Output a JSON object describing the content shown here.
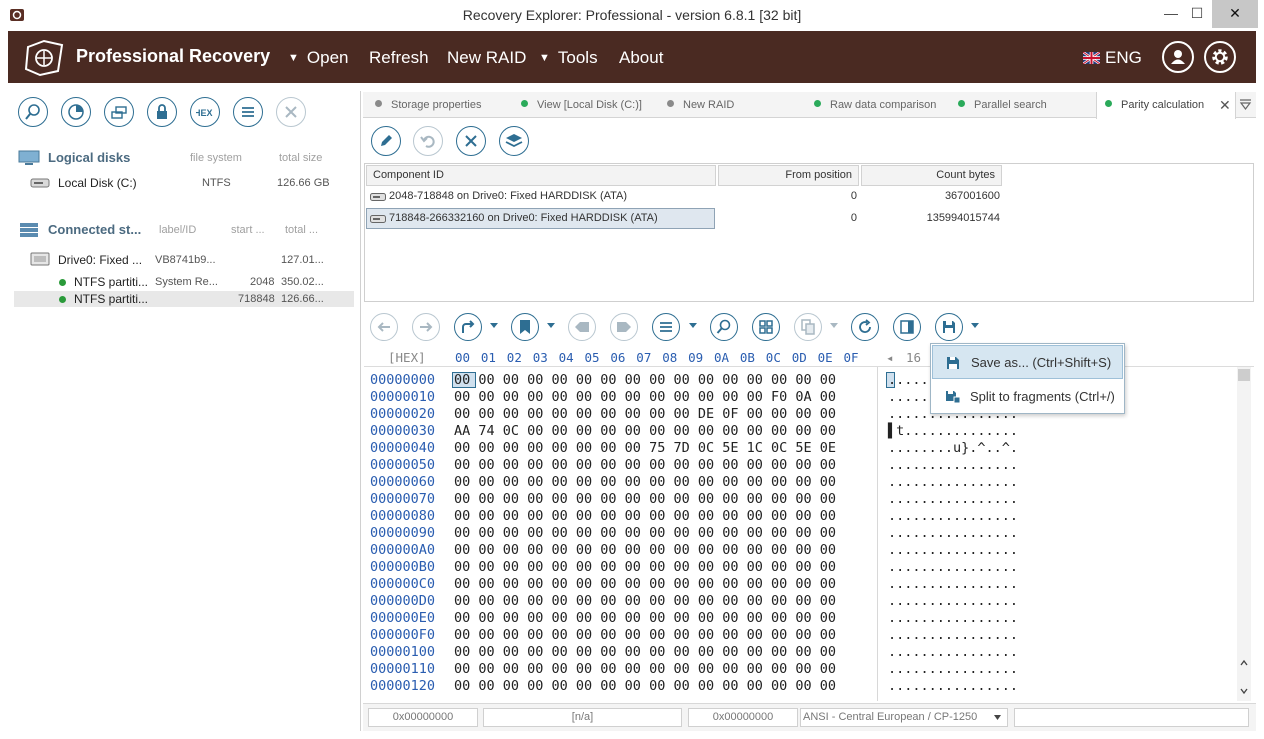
{
  "window": {
    "title": "Recovery Explorer: Professional - version 6.8.1 [32 bit]",
    "minimize": "—",
    "maximize": "☐",
    "close": "✕"
  },
  "menubar": {
    "brand": "Professional Recovery",
    "items": {
      "open": "Open",
      "refresh": "Refresh",
      "new_raid": "New RAID",
      "tools": "Tools",
      "about": "About"
    },
    "dropdown_caret": "▼",
    "language": "ENG"
  },
  "left": {
    "logical": {
      "title": "Logical disks",
      "col_fs": "file system",
      "col_size": "total size",
      "rows": [
        {
          "name": "Local Disk (C:)",
          "fs": "NTFS",
          "size": "126.66 GB"
        }
      ]
    },
    "connected": {
      "title": "Connected st...",
      "col_label": "label/ID",
      "col_start": "start ...",
      "col_total": "total ...",
      "drive": {
        "name": "Drive0: Fixed ...",
        "label": "VB8741b9...",
        "total": "127.01..."
      },
      "partitions": [
        {
          "name": "NTFS partiti...",
          "label": "System Re...",
          "start": "2048",
          "total": "350.02..."
        },
        {
          "name": "NTFS partiti...",
          "label": "",
          "start": "718848",
          "total": "126.66..."
        }
      ]
    }
  },
  "tabs": [
    {
      "label": "Storage properties",
      "dot": "#8a8a8a"
    },
    {
      "label": "View [Local Disk (C:)]",
      "dot": "#2aaa5a"
    },
    {
      "label": "New RAID",
      "dot": "#8a8a8a"
    },
    {
      "label": "Raw data comparison",
      "dot": "#2aaa5a"
    },
    {
      "label": "Parallel search",
      "dot": "#2aaa5a"
    },
    {
      "label": "Parity calculation",
      "dot": "#2aaa5a",
      "close": "✕"
    }
  ],
  "component_table": {
    "headers": {
      "id": "Component ID",
      "from": "From position",
      "count": "Count bytes"
    },
    "rows": [
      {
        "id": "2048-718848 on Drive0: Fixed HARDDISK (ATA)",
        "from": "0",
        "count": "367001600"
      },
      {
        "id": "718848-266332160 on Drive0: Fixed HARDDISK (ATA)",
        "from": "0",
        "count": "135994015744"
      }
    ]
  },
  "hex": {
    "header_label": "[HEX]",
    "columns": [
      "00",
      "01",
      "02",
      "03",
      "04",
      "05",
      "06",
      "07",
      "08",
      "09",
      "0A",
      "0B",
      "0C",
      "0D",
      "0E",
      "0F"
    ],
    "width_label": "16",
    "rows": [
      {
        "off": "00000000",
        "bytes": "00 00 00 00 00 00 00 00 00 00 00 00 00 00 00 00",
        "ascii": "................"
      },
      {
        "off": "00000010",
        "bytes": "00 00 00 00 00 00 00 00 00 00 00 00 00 F0 0A 00",
        "ascii": "................"
      },
      {
        "off": "00000020",
        "bytes": "00 00 00 00 00 00 00 00 00 00 DE 0F 00 00 00 00",
        "ascii": "................"
      },
      {
        "off": "00000030",
        "bytes": "AA 74 0C 00 00 00 00 00 00 00 00 00 00 00 00 00",
        "ascii": "▌t.............."
      },
      {
        "off": "00000040",
        "bytes": "00 00 00 00 00 00 00 00 75 7D 0C 5E 1C 0C 5E 0E",
        "ascii": "........u}.^..^."
      },
      {
        "off": "00000050",
        "bytes": "00 00 00 00 00 00 00 00 00 00 00 00 00 00 00 00",
        "ascii": "................"
      },
      {
        "off": "00000060",
        "bytes": "00 00 00 00 00 00 00 00 00 00 00 00 00 00 00 00",
        "ascii": "................"
      },
      {
        "off": "00000070",
        "bytes": "00 00 00 00 00 00 00 00 00 00 00 00 00 00 00 00",
        "ascii": "................"
      },
      {
        "off": "00000080",
        "bytes": "00 00 00 00 00 00 00 00 00 00 00 00 00 00 00 00",
        "ascii": "................"
      },
      {
        "off": "00000090",
        "bytes": "00 00 00 00 00 00 00 00 00 00 00 00 00 00 00 00",
        "ascii": "................"
      },
      {
        "off": "000000A0",
        "bytes": "00 00 00 00 00 00 00 00 00 00 00 00 00 00 00 00",
        "ascii": "................"
      },
      {
        "off": "000000B0",
        "bytes": "00 00 00 00 00 00 00 00 00 00 00 00 00 00 00 00",
        "ascii": "................"
      },
      {
        "off": "000000C0",
        "bytes": "00 00 00 00 00 00 00 00 00 00 00 00 00 00 00 00",
        "ascii": "................"
      },
      {
        "off": "000000D0",
        "bytes": "00 00 00 00 00 00 00 00 00 00 00 00 00 00 00 00",
        "ascii": "................"
      },
      {
        "off": "000000E0",
        "bytes": "00 00 00 00 00 00 00 00 00 00 00 00 00 00 00 00",
        "ascii": "................"
      },
      {
        "off": "000000F0",
        "bytes": "00 00 00 00 00 00 00 00 00 00 00 00 00 00 00 00",
        "ascii": "................"
      },
      {
        "off": "00000100",
        "bytes": "00 00 00 00 00 00 00 00 00 00 00 00 00 00 00 00",
        "ascii": "................"
      },
      {
        "off": "00000110",
        "bytes": "00 00 00 00 00 00 00 00 00 00 00 00 00 00 00 00",
        "ascii": "................"
      },
      {
        "off": "00000120",
        "bytes": "00 00 00 00 00 00 00 00 00 00 00 00 00 00 00 00",
        "ascii": "................"
      }
    ]
  },
  "save_menu": {
    "save_as": "Save as... (Ctrl+Shift+S)",
    "split": "Split to fragments (Ctrl+/)"
  },
  "statusbar": {
    "offset": "0x00000000",
    "value": "[n/a]",
    "position": "0x00000000",
    "encoding": "ANSI - Central European / CP-1250"
  }
}
